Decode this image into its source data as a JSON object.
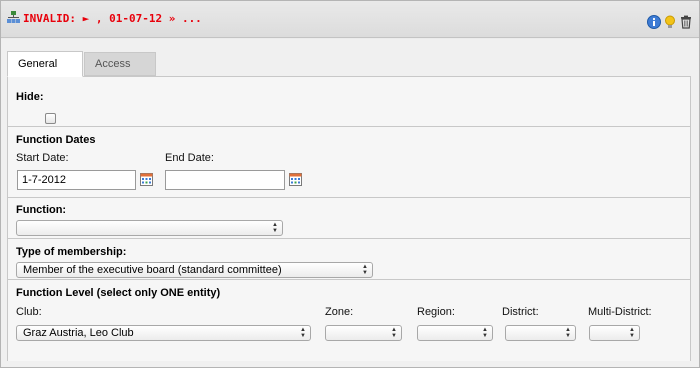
{
  "header": {
    "title": "INVALID: ► , 01-07-12 » ...",
    "record_icon": "record-tree-icon",
    "actions": [
      {
        "name": "info-icon",
        "color": "#3d7bd4"
      },
      {
        "name": "lightbulb-icon",
        "color": "#f2c318"
      },
      {
        "name": "trash-icon",
        "color": "#444444"
      }
    ]
  },
  "tabs": [
    {
      "label": "General",
      "active": true
    },
    {
      "label": "Access",
      "active": false
    }
  ],
  "hide": {
    "label": "Hide:",
    "checked": false
  },
  "function_dates": {
    "title": "Function Dates",
    "start_label": "Start Date:",
    "start_value": "1-7-2012",
    "end_label": "End Date:",
    "end_value": ""
  },
  "function": {
    "label": "Function:",
    "selected": ""
  },
  "membership": {
    "label": "Type of membership:",
    "selected": "Member of the executive board (standard committee)"
  },
  "function_level": {
    "title": "Function Level (select only ONE entity)",
    "club_label": "Club:",
    "club_selected": "Graz Austria, Leo Club",
    "zone_label": "Zone:",
    "region_label": "Region:",
    "district_label": "District:",
    "multi_district_label": "Multi-District:"
  },
  "colors": {
    "title_red": "#e8000b",
    "accent_blue": "#3d7bd4"
  }
}
